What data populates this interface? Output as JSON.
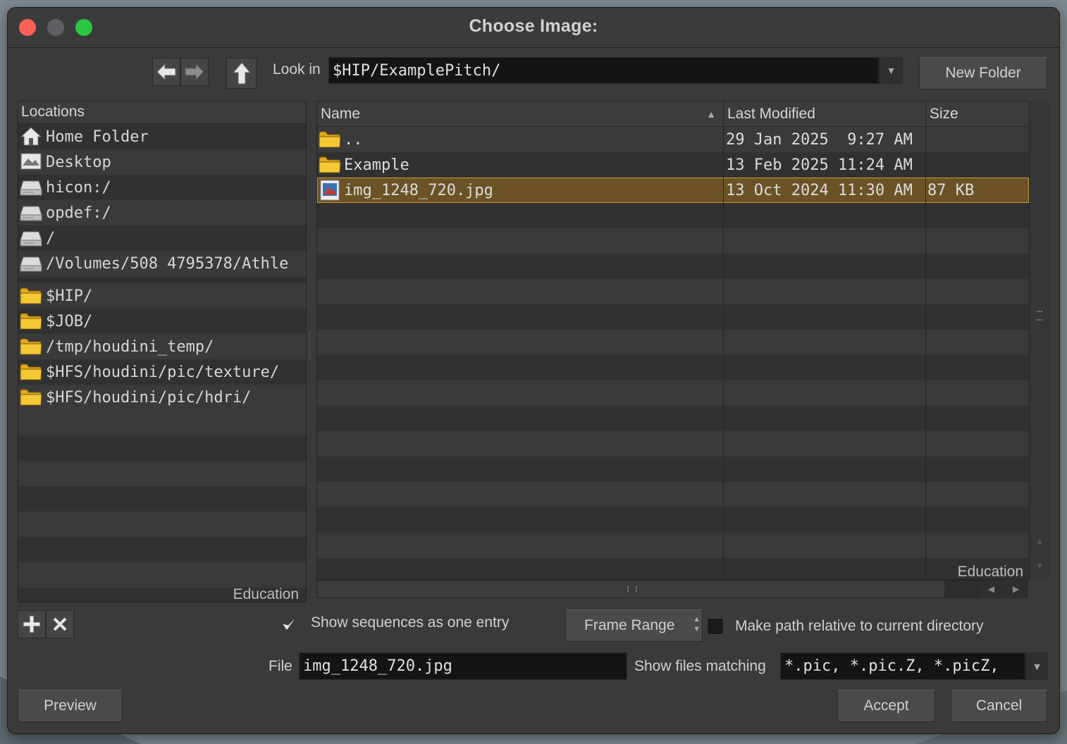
{
  "window": {
    "title": "Choose Image:"
  },
  "toolbar": {
    "look_in_label": "Look in",
    "look_in_value": "$HIP/ExamplePitch/",
    "new_folder_label": "New Folder"
  },
  "locations": {
    "header": "Locations",
    "items": [
      {
        "label": "Home Folder",
        "icon": "home-icon"
      },
      {
        "label": "Desktop",
        "icon": "desktop-icon"
      },
      {
        "label": "hicon:/",
        "icon": "drive-icon"
      },
      {
        "label": "opdef:/",
        "icon": "drive-icon"
      },
      {
        "label": "/",
        "icon": "drive-icon"
      },
      {
        "label": "/Volumes/508 4795378/Athle",
        "icon": "drive-icon"
      }
    ],
    "bookmarks": [
      {
        "label": "$HIP/",
        "icon": "folder-icon"
      },
      {
        "label": "$JOB/",
        "icon": "folder-icon"
      },
      {
        "label": "/tmp/houdini_temp/",
        "icon": "folder-icon"
      },
      {
        "label": "$HFS/houdini/pic/texture/",
        "icon": "folder-icon"
      },
      {
        "label": "$HFS/houdini/pic/hdri/",
        "icon": "folder-icon"
      }
    ],
    "watermark": "Education"
  },
  "file_list": {
    "columns": [
      "Name",
      "Last Modified",
      "Size"
    ],
    "sort_indicator": "▲",
    "rows": [
      {
        "name": "..",
        "modified": "29 Jan 2025  9:27 AM",
        "size": "",
        "icon": "folder-icon",
        "selected": false
      },
      {
        "name": "Example",
        "modified": "13 Feb 2025 11:24 AM",
        "size": "",
        "icon": "folder-icon",
        "selected": false
      },
      {
        "name": "img_1248_720.jpg",
        "modified": "13 Oct 2024 11:30 AM",
        "size": "87 KB",
        "icon": "image-file-icon",
        "selected": true
      }
    ],
    "watermark": "Education"
  },
  "options": {
    "show_sequences_label": "Show sequences as one entry",
    "show_sequences_checked": true,
    "frame_range_label": "Frame Range",
    "relative_path_label": "Make path relative to current directory",
    "relative_path_checked": false
  },
  "file": {
    "label": "File",
    "value": "img_1248_720.jpg",
    "filter_label": "Show files matching",
    "filter_value": "*.pic, *.pic.Z, *.picZ,"
  },
  "buttons": {
    "preview": "Preview",
    "accept": "Accept",
    "cancel": "Cancel"
  },
  "colors": {
    "selection": "#6b5327",
    "selection_border": "#c79a3c",
    "folder": "#f2c230",
    "close": "#fe5f57",
    "minimize": "#5f5f63",
    "zoom": "#28c840"
  }
}
